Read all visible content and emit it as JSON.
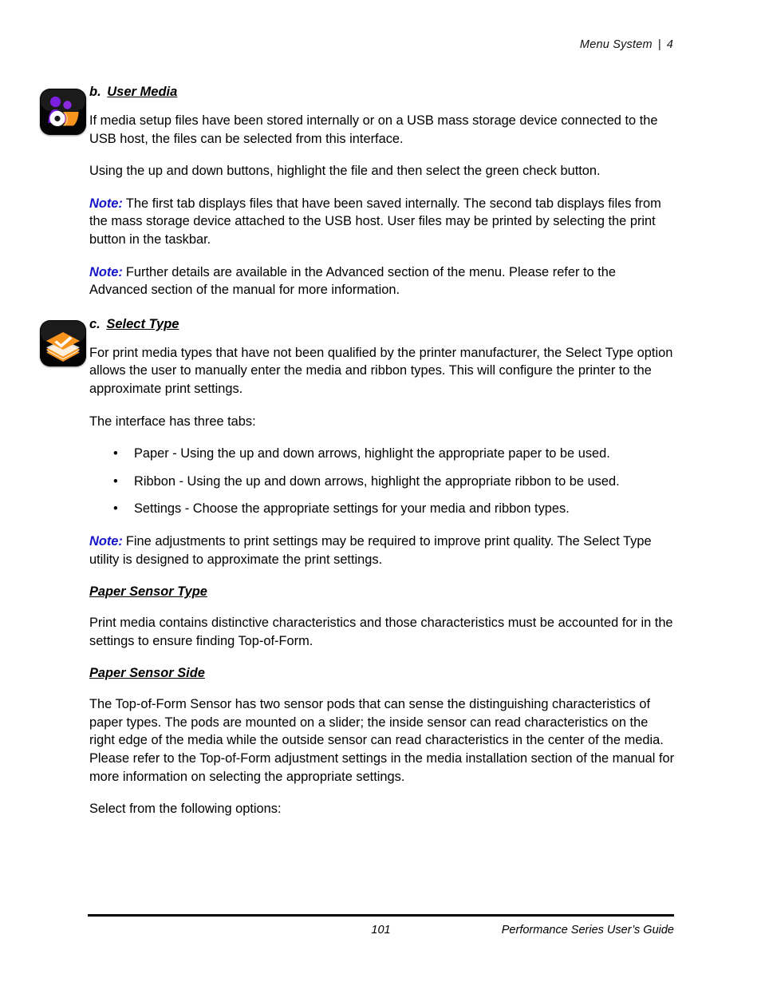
{
  "header": {
    "chapter_title": "Menu System",
    "separator": "|",
    "chapter_number": "4"
  },
  "colors": {
    "note_blue": "#1414c8",
    "icon_background": "#000000",
    "icon_purple": "#8a2be2",
    "icon_orange": "#f7941e",
    "text": "#000000"
  },
  "sections": [
    {
      "icon_name": "user-media-icon",
      "heading_letter": "b.",
      "heading_title": "User Media",
      "paragraphs": [
        "If media setup files have been stored internally or on a USB mass storage device connected to the USB host, the files can be selected from this interface.",
        "Using the up and down buttons, highlight the file and then select the green check button."
      ],
      "notes": [
        {
          "label": "Note:",
          "text": "The first tab displays files that have been saved internally. The second tab displays files from the mass storage device attached to the USB host. User files may be printed by selecting the print button in the taskbar."
        },
        {
          "label": "Note:",
          "text": "Further details are available in the Advanced section of the menu. Please refer to the Advanced section of the manual for more information."
        }
      ]
    },
    {
      "icon_name": "select-type-icon",
      "heading_letter": "c.",
      "heading_title": "Select Type",
      "paragraphs": [
        "For print media types that have not been qualified by the printer manufacturer, the Select Type option allows the user to manually enter the media and ribbon types. This will configure the printer to the approximate print settings.",
        "The interface has three tabs:"
      ],
      "bullet_marker": "•",
      "bullets": [
        "Paper - Using the up and down arrows, highlight the appropriate paper to be used.",
        "Ribbon - Using the up and down arrows, highlight the appropriate ribbon to be used.",
        "Settings - Choose the appropriate settings for your media and ribbon types."
      ],
      "notes": [
        {
          "label": "Note:",
          "text": "Fine adjustments to print settings may be required to improve print quality. The Select Type utility is designed to approximate the print settings."
        }
      ]
    }
  ],
  "subsections": [
    {
      "heading": "Paper Sensor Type",
      "paragraphs": [
        "Print media contains distinctive characteristics and those characteristics must be accounted for in the settings to ensure finding Top-of-Form."
      ]
    },
    {
      "heading": "Paper Sensor Side",
      "paragraphs": [
        "The Top-of-Form Sensor has two sensor pods that can sense the distinguishing characteristics of paper types. The pods are mounted on a slider; the inside sensor can read characteristics on the right edge of the media while the outside sensor can read characteristics in the center of the media. Please refer to the Top-of-Form adjustment settings in the media installation section of the manual for more information on selecting the appropriate settings.",
        "Select from the following options:"
      ]
    }
  ],
  "footer": {
    "page_number": "101",
    "guide_title": "Performance Series User’s Guide"
  }
}
